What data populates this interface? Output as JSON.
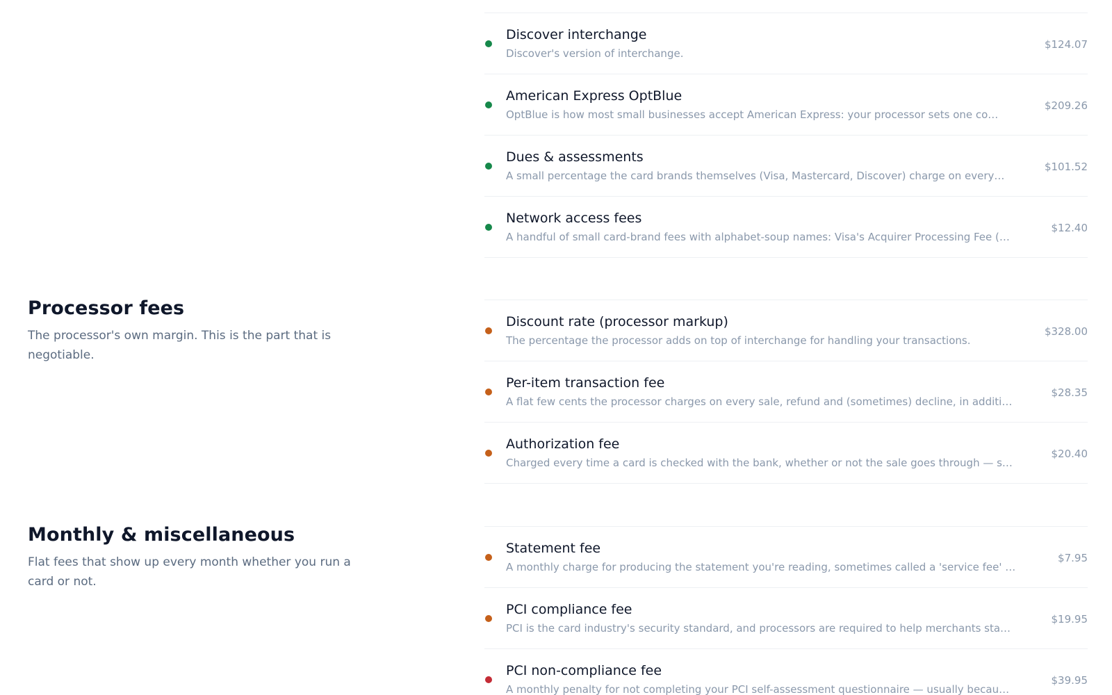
{
  "card_brand_fees": {
    "items": [
      {
        "name": "Discover interchange",
        "desc": "Discover's version of interchange.",
        "amount": "$124.07",
        "status_color": "#16884a"
      },
      {
        "name": "American Express OptBlue",
        "desc": "OptBlue is how most small businesses accept American Express: your processor sets one co…",
        "amount": "$209.26",
        "status_color": "#16884a"
      },
      {
        "name": "Dues & assessments",
        "desc": "A small percentage the card brands themselves (Visa, Mastercard, Discover) charge on every…",
        "amount": "$101.52",
        "status_color": "#16884a"
      },
      {
        "name": "Network access fees",
        "desc": "A handful of small card-brand fees with alphabet-soup names: Visa's Acquirer Processing Fee (…",
        "amount": "$12.40",
        "status_color": "#16884a"
      }
    ]
  },
  "processor_fees": {
    "title": "Processor fees",
    "description": "The processor's own margin. This is the part that is negotiable.",
    "items": [
      {
        "name": "Discount rate (processor markup)",
        "desc": "The percentage the processor adds on top of interchange for handling your transactions.",
        "amount": "$328.00",
        "status_color": "#c5601a"
      },
      {
        "name": "Per-item transaction fee",
        "desc": "A flat few cents the processor charges on every sale, refund and (sometimes) decline, in additi…",
        "amount": "$28.35",
        "status_color": "#c5601a"
      },
      {
        "name": "Authorization fee",
        "desc": "Charged every time a card is checked with the bank, whether or not the sale goes through — s…",
        "amount": "$20.40",
        "status_color": "#c5601a"
      }
    ]
  },
  "monthly_misc": {
    "title": "Monthly & miscellaneous",
    "description": "Flat fees that show up every month whether you run a card or not.",
    "items": [
      {
        "name": "Statement fee",
        "desc": "A monthly charge for producing the statement you're reading, sometimes called a 'service fee' …",
        "amount": "$7.95",
        "status_color": "#c5601a"
      },
      {
        "name": "PCI compliance fee",
        "desc": "PCI is the card industry's security standard, and processors are required to help merchants sta…",
        "amount": "$19.95",
        "status_color": "#c5601a"
      },
      {
        "name": "PCI non-compliance fee",
        "desc": "A monthly penalty for not completing your PCI self-assessment questionnaire — usually becau…",
        "amount": "$39.95",
        "status_color": "#c42c36"
      }
    ]
  }
}
